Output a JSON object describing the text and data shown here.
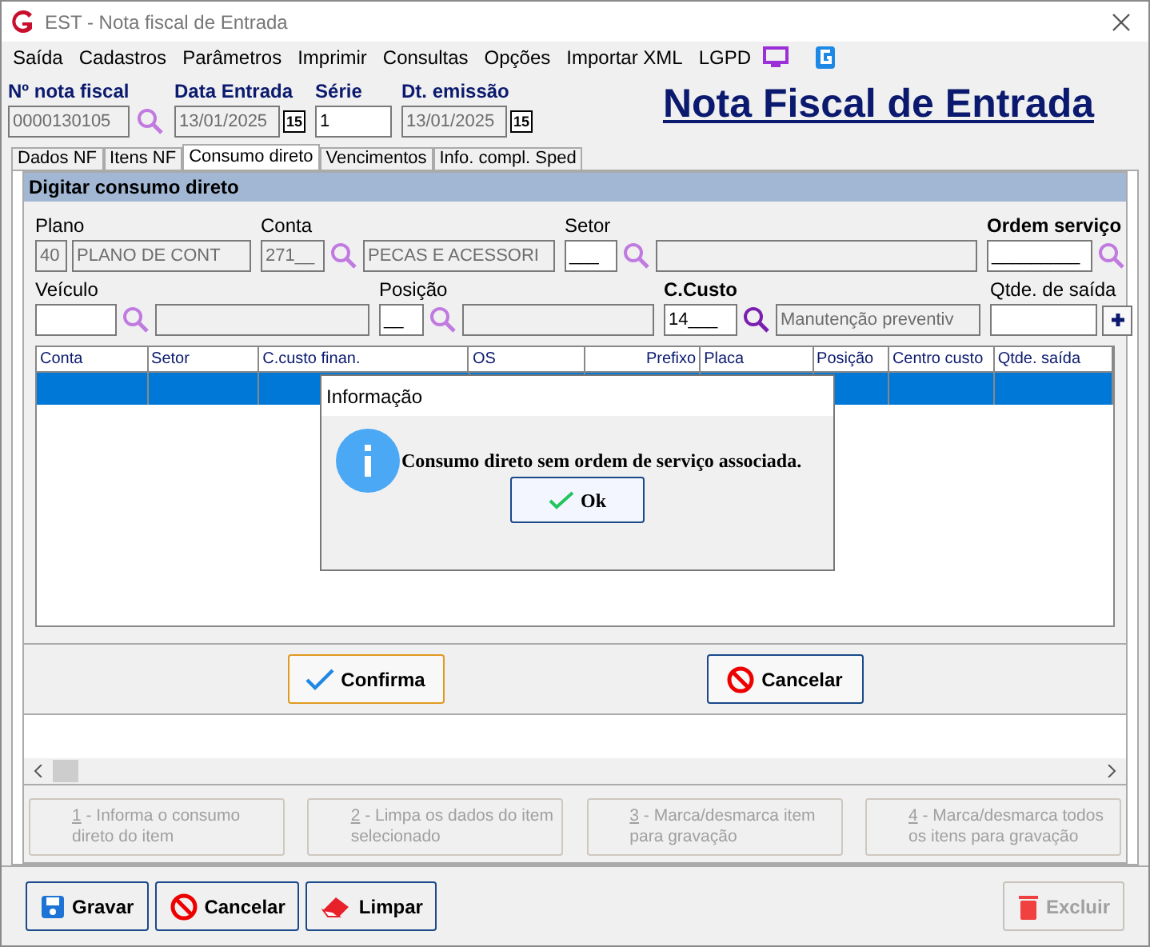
{
  "window": {
    "title": "EST - Nota fiscal de Entrada"
  },
  "menu": [
    {
      "label": "Saída"
    },
    {
      "label": "Cadastros"
    },
    {
      "label": "Parâmetros"
    },
    {
      "label": "Imprimir"
    },
    {
      "label": "Consultas"
    },
    {
      "label": "Opções"
    },
    {
      "label": "Importar XML"
    },
    {
      "label": "LGPD"
    }
  ],
  "header": {
    "fields": [
      {
        "label": "Nº nota fiscal",
        "value": "0000130105",
        "kind": "search"
      },
      {
        "label": "Data Entrada",
        "value": "13/01/2025",
        "kind": "date",
        "icon_text": "15"
      },
      {
        "label": "Série",
        "value": "1",
        "kind": "plain"
      },
      {
        "label": "Dt. emissão",
        "value": "13/01/2025",
        "kind": "date",
        "icon_text": "15"
      }
    ],
    "page_title": "Nota Fiscal de Entrada"
  },
  "tabs": [
    {
      "label": "Dados NF",
      "selected": false
    },
    {
      "label": "Itens NF",
      "selected": false
    },
    {
      "label": "Consumo direto",
      "selected": true
    },
    {
      "label": "Vencimentos",
      "selected": false
    },
    {
      "label": "Info. compl. Sped",
      "selected": false
    }
  ],
  "panel": {
    "title": "Digitar consumo direto",
    "row1": {
      "plano": {
        "label": "Plano",
        "code": "40",
        "name": "PLANO DE CONT"
      },
      "conta": {
        "label": "Conta",
        "code": "271__",
        "name": "PECAS E ACESSORI"
      },
      "setor": {
        "label": "Setor",
        "code": "___"
      },
      "ordem": {
        "label": "Ordem serviço",
        "code": "_________"
      }
    },
    "row2": {
      "veiculo": {
        "label": "Veículo"
      },
      "posicao": {
        "label": "Posição",
        "code": "__"
      },
      "ccusto": {
        "label": "C.Custo",
        "code": "14___",
        "name": "Manutenção preventiv"
      },
      "qtde": {
        "label": "Qtde. de saída"
      }
    },
    "grid": {
      "columns": [
        "Conta",
        "Setor",
        "C.custo finan.",
        "OS",
        "Prefixo",
        "Placa",
        "Posição",
        "Centro custo",
        "Qtde. saída"
      ],
      "rows": [
        {
          "selected": true
        }
      ]
    },
    "confirm": "Confirma",
    "cancel": "Cancelar",
    "steps": [
      {
        "number": "1",
        "text": " - Informa o consumo direto do item",
        "disabled": true
      },
      {
        "number": "2",
        "text": " - Limpa os dados do item selecionado",
        "disabled": true
      },
      {
        "number": "3",
        "text": " - Marca/desmarca item para gravação",
        "disabled": true
      },
      {
        "number": "4",
        "text": " - Marca/desmarca todos os itens para gravação",
        "disabled": true
      }
    ]
  },
  "footer": [
    {
      "label": "Gravar",
      "kind": "save",
      "disabled": false
    },
    {
      "label": "Cancelar",
      "kind": "cancel",
      "disabled": false
    },
    {
      "label": "Limpar",
      "kind": "clear",
      "disabled": false
    },
    {
      "label": "Excluir",
      "kind": "delete",
      "disabled": true
    }
  ],
  "dialog": {
    "title": "Informação",
    "message": "Consumo direto sem ordem de serviço associada.",
    "button": "Ok"
  }
}
